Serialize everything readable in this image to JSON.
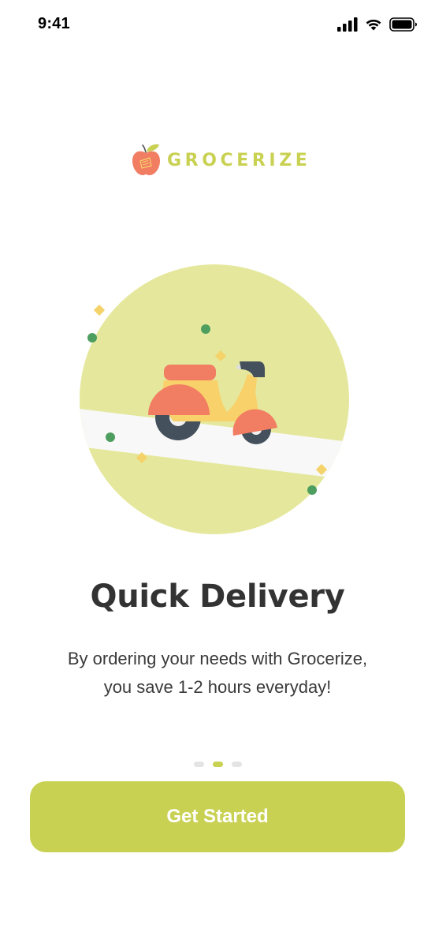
{
  "status_bar": {
    "time": "9:41",
    "icons": [
      "cellular-signal-icon",
      "wifi-icon",
      "battery-icon"
    ]
  },
  "logo": {
    "icon": "apple-icon",
    "text": "GROCERIZE"
  },
  "illustration": {
    "subject": "scooter-icon"
  },
  "onboarding": {
    "title": "Quick Delivery",
    "description_line1": "By ordering your needs with Grocerize,",
    "description_line2": "you save 1-2 hours everyday!"
  },
  "pager": {
    "total": 3,
    "active_index": 1
  },
  "cta": {
    "label": "Get Started"
  },
  "colors": {
    "accent": "#c9d153",
    "circle": "#e5e89c",
    "coral": "#f17d62",
    "scooter_body": "#f8d16a",
    "tire": "#44505c",
    "confetti_green": "#4d9e5f",
    "confetti_yellow": "#f4d36a",
    "text_dark": "#333333",
    "dot_inactive": "#e4e4e4"
  }
}
